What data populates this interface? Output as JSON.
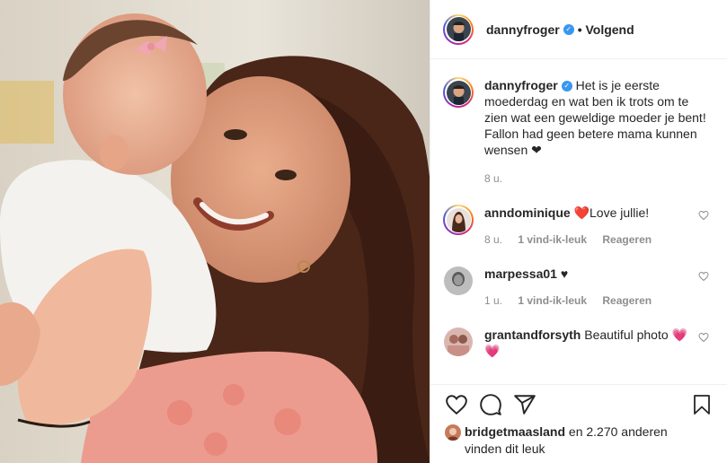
{
  "post": {
    "author": "dannyfroger",
    "follow_status": "• Volgend",
    "caption": "Het is je eerste moederdag en wat ben ik trots om te zien wat een geweldige moeder je bent! Fallon had geen betere mama kunnen wensen ❤",
    "time": "8 u."
  },
  "comments": [
    {
      "user": "anndominique",
      "text": "❤️Love jullie!",
      "time": "8 u.",
      "likes": "1 vind-ik-leuk",
      "reply": "Reageren"
    },
    {
      "user": "marpessa01",
      "text": "♥",
      "time": "1 u.",
      "likes": "1 vind-ik-leuk",
      "reply": "Reageren"
    },
    {
      "user": "grantandforsyth",
      "text": "Beautiful photo 💗💗"
    }
  ],
  "likes": {
    "user": "bridgetmaasland",
    "rest": "en 2.270 anderen",
    "line2": "vinden dit leuk"
  },
  "icons": [
    "heart-icon",
    "comment-icon",
    "share-icon",
    "bookmark-icon",
    "verified-badge-icon"
  ],
  "colors": {
    "verified": "#3897f0",
    "text": "#262626",
    "meta": "#8e8e8e",
    "heart_red": "#ed4956"
  }
}
